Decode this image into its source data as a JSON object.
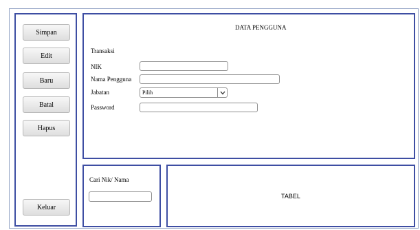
{
  "buttons": {
    "save": "Simpan",
    "edit": "Edit",
    "new": "Baru",
    "cancel": "Batal",
    "delete": "Hapus",
    "exit": "Keluar"
  },
  "form": {
    "title": "DATA PENGGUNA",
    "section": "Transaksi",
    "nik_label": "NIK",
    "nik_value": "",
    "username_label": "Nama Pengguna",
    "username_value": "",
    "position_label": "Jabatan",
    "position_selected": "Pilih",
    "password_label": "Password",
    "password_value": ""
  },
  "search": {
    "label": "Cari Nik/ Nama",
    "value": ""
  },
  "table": {
    "label": "TABEL"
  },
  "colors": {
    "panel_border": "#3e4ea3",
    "outer_border": "#9aa9c9"
  },
  "icons": {
    "dropdown": "chevron-down-icon"
  }
}
